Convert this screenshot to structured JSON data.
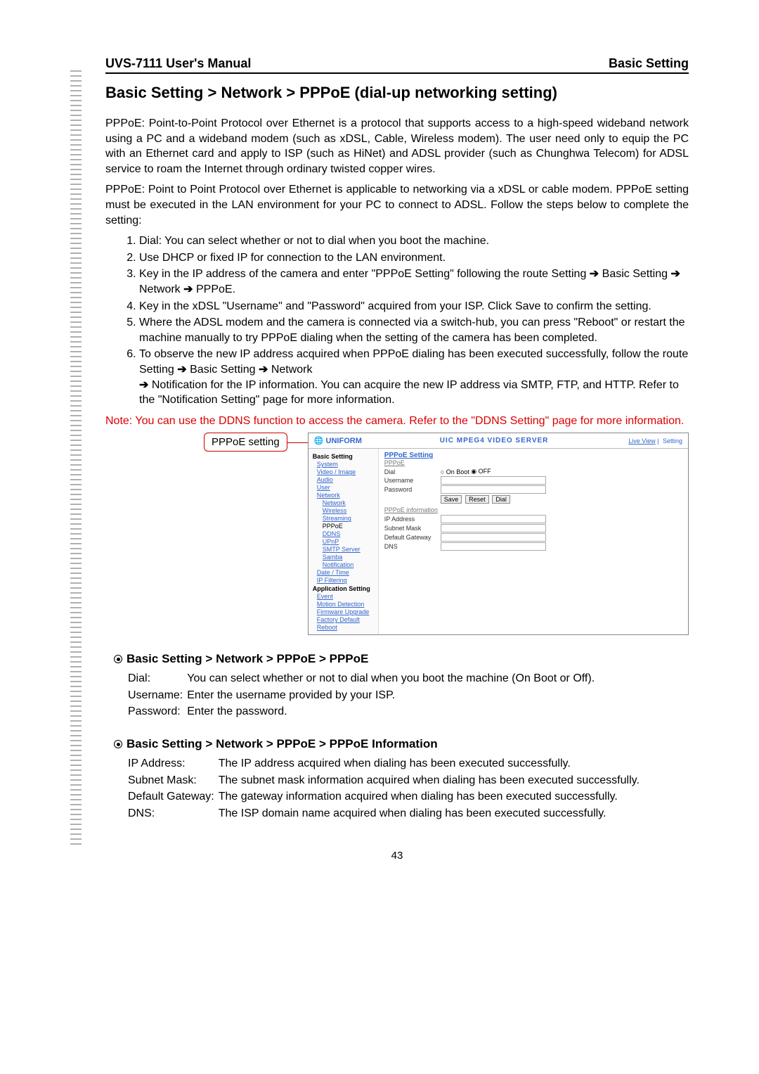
{
  "header": {
    "left": "UVS-7111 User's Manual",
    "right": "Basic Setting"
  },
  "title": "Basic Setting > Network > PPPoE (dial-up networking setting)",
  "para1": "PPPoE: Point-to-Point Protocol over Ethernet is a protocol that supports access to a high-speed wideband network using a PC and a wideband modem (such as xDSL, Cable, Wireless modem). The user need only to equip the PC with an Ethernet card and apply to ISP (such as HiNet) and ADSL provider (such as Chunghwa Telecom) for ADSL service to roam the Internet through ordinary twisted copper wires.",
  "para2": "PPPoE: Point to Point Protocol over Ethernet is applicable to networking via a xDSL or cable modem. PPPoE setting must be executed in the LAN environment for your PC to connect to ADSL. Follow the steps below to complete the setting:",
  "steps": {
    "s1": "Dial: You can select whether or not to dial when you boot the machine.",
    "s2": "Use DHCP or fixed IP for connection to the LAN environment.",
    "s3a": "Key in the IP address of the camera and enter \"PPPoE Setting\" following the route Setting ",
    "s3b": " Basic Setting ",
    "s3c": " Network ",
    "s3d": " PPPoE.",
    "s4": "Key in the xDSL \"Username\" and \"Password\" acquired from your ISP. Click Save to confirm the setting.",
    "s5": "Where the ADSL modem and the camera is connected via a switch-hub, you can press \"Reboot\" or restart the machine manually to try PPPoE dialing when the setting of the camera has been completed.",
    "s6a": "To observe the new IP address acquired when PPPoE dialing has been executed successfully, follow the route Setting ",
    "s6b": " Basic Setting ",
    "s6c": " Network ",
    "s6d": " Notification for the IP information. You can acquire the new IP address via SMTP, FTP, and HTTP. Refer to the \"Notification Setting\" page for more information."
  },
  "note": "Note: You can use the DDNS function to access the camera. Refer to the \"DDNS Setting\" page for more information.",
  "callout": "PPPoE setting",
  "screenshot": {
    "logo": "UNIFORM",
    "center": "UIC MPEG4 VIDEO SERVER",
    "live": "Live View",
    "setting": "Setting",
    "side": {
      "basic": "Basic Setting",
      "system": "System",
      "video": "Video / Image",
      "audio": "Audio",
      "user": "User",
      "network": "Network",
      "net": "Network",
      "wireless": "Wireless",
      "streaming": "Streaming",
      "pppoe": "PPPoE",
      "ddns": "DDNS",
      "upnp": "UPnP",
      "smtp": "SMTP Server",
      "samba": "Samba",
      "notif": "Notification",
      "date": "Date / Time",
      "ipf": "IP Filtering",
      "app": "Application Setting",
      "event": "Event",
      "motion": "Motion Detection",
      "firmware": "Firmware Upgrade",
      "factory": "Factory Default",
      "reboot": "Reboot"
    },
    "main": {
      "h": "PPPoE Setting",
      "sub1": "PPPoE",
      "dial": "Dial",
      "onboot": "On Boot",
      "off": "OFF",
      "user": "Username",
      "pass": "Password",
      "save": "Save",
      "reset": "Reset",
      "dialbtn": "Dial",
      "sub2": "PPPoE information",
      "ip": "IP Address",
      "mask": "Subnet Mask",
      "gw": "Default Gateway",
      "dns": "DNS"
    }
  },
  "sec1": {
    "h": "Basic Setting > Network > PPPoE > PPPoE",
    "dial_k": "Dial:",
    "dial_v": "You can select whether or not to dial when you boot the machine (On Boot or Off).",
    "user_k": "Username:",
    "user_v": "Enter the username provided by your ISP.",
    "pass_k": "Password:",
    "pass_v": "Enter the password."
  },
  "sec2": {
    "h": "Basic Setting > Network > PPPoE > PPPoE Information",
    "ip_k": "IP Address:",
    "ip_v": "The IP address acquired when dialing has been executed successfully.",
    "mask_k": "Subnet Mask:",
    "mask_v": "The subnet mask information acquired when dialing has been executed successfully.",
    "gw_k": "Default Gateway:",
    "gw_v": "The gateway information acquired when dialing has been executed successfully.",
    "dns_k": "DNS:",
    "dns_v": "The ISP domain name acquired when dialing has been executed successfully."
  },
  "footer": "43"
}
